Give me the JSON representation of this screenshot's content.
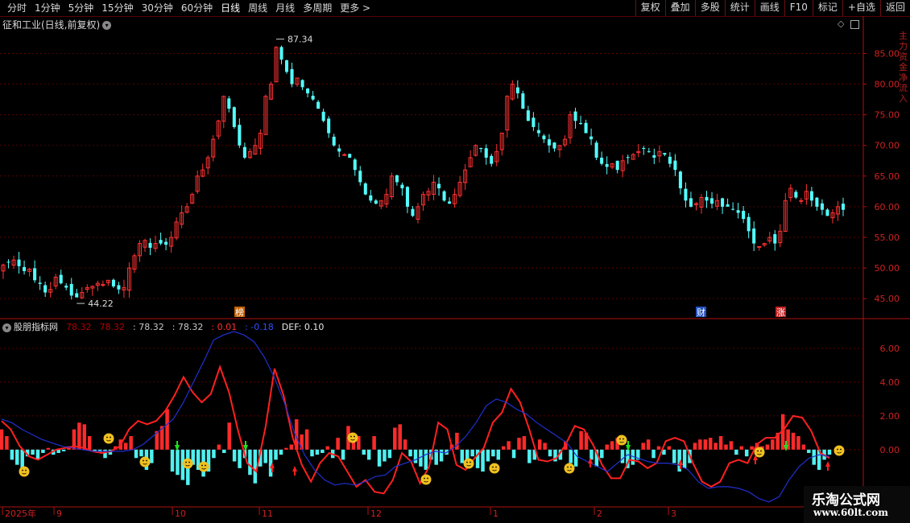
{
  "toolbar": {
    "periods": [
      "分时",
      "1分钟",
      "5分钟",
      "15分钟",
      "30分钟",
      "60分钟",
      "日线",
      "周线",
      "月线",
      "多周期",
      "更多 >"
    ],
    "active_period": "日线",
    "actions": [
      "复权",
      "叠加",
      "多股",
      "统计",
      "画线",
      "F10",
      "标记",
      "+自选",
      "返回"
    ]
  },
  "main_chart": {
    "title": "征和工业(日线,前复权)",
    "high_label": "87.34",
    "low_label": "44.22",
    "y_ticks": [
      "85.00",
      "80.00",
      "75.00",
      "70.00",
      "65.00",
      "60.00",
      "55.00",
      "50.00",
      "45.00"
    ],
    "badges": [
      {
        "text": "榜",
        "color": "#c06000"
      },
      {
        "text": "财",
        "color": "#2050c0"
      },
      {
        "text": "涨",
        "color": "#c02020"
      }
    ],
    "side_text": "主力资金净流入"
  },
  "indicator": {
    "name": "股朋指标网",
    "values": [
      {
        "text": "78.32",
        "color": "#b00000"
      },
      {
        "text": "78.32",
        "color": "#b00000"
      },
      {
        "text": ": 78.32",
        "color": "#c8c8c8"
      },
      {
        "text": ": 78.32",
        "color": "#c8c8c8"
      },
      {
        "text": ": 0.01",
        "color": "#ff3030"
      },
      {
        "text": ": -0.18",
        "color": "#3050ff"
      },
      {
        "text": "DEF: 0.10",
        "color": "#e8e8e8"
      }
    ],
    "y_ticks": [
      "6.00",
      "4.00",
      "2.00",
      "0.00"
    ]
  },
  "x_axis": {
    "labels": [
      "2025年",
      "9",
      "10",
      "11",
      "12",
      "1",
      "2",
      "3"
    ]
  },
  "watermark": {
    "line1": "乐淘公式网",
    "line2": "www.60lt.com"
  },
  "colors": {
    "up": "#ff3232",
    "down": "#54ffff",
    "grid": "#5a0000",
    "axis": "#b01010",
    "red_line": "#ff2020",
    "blue_line": "#2030d0"
  },
  "chart_data": [
    {
      "type": "candlestick",
      "title": "征和工业(日线,前复权)",
      "ylim": [
        42,
        89
      ],
      "annotations": {
        "max": 87.34,
        "min": 44.22
      },
      "closes": [
        50.5,
        51.0,
        51.3,
        50.3,
        49.5,
        49.8,
        48.0,
        47.4,
        46.0,
        46.5,
        48.5,
        47.5,
        46.8,
        45.5,
        45.2,
        46.0,
        46.8,
        47.0,
        47.5,
        47.3,
        48.0,
        47.0,
        46.5,
        46.8,
        50.0,
        52.0,
        54.0,
        54.5,
        53.3,
        54.0,
        54.0,
        53.8,
        55.0,
        57.5,
        59.0,
        60.0,
        62.0,
        65.0,
        66.0,
        68.0,
        71.0,
        74.0,
        78.0,
        76.0,
        73.0,
        70.0,
        68.0,
        69.0,
        70.0,
        72.0,
        78.0,
        80.0,
        86.0,
        84.0,
        82.0,
        80.0,
        81.0,
        79.5,
        78.5,
        77.5,
        76.0,
        74.0,
        72.0,
        70.0,
        69.0,
        68.5,
        68.0,
        66.0,
        64.0,
        62.0,
        61.0,
        60.5,
        61.0,
        62.0,
        65.0,
        64.0,
        63.0,
        60.0,
        58.5,
        60.0,
        62.0,
        62.5,
        64.0,
        63.0,
        61.0,
        60.5,
        62.0,
        64.0,
        66.0,
        68.0,
        70.0,
        69.5,
        68.0,
        67.0,
        69.0,
        72.0,
        78.0,
        80.0,
        78.5,
        76.0,
        74.0,
        73.0,
        72.0,
        71.0,
        70.0,
        69.5,
        70.0,
        71.0,
        75.0,
        74.0,
        73.5,
        72.0,
        71.0,
        68.0,
        67.0,
        66.5,
        67.0,
        66.0,
        67.5,
        68.0,
        68.5,
        69.0,
        69.5,
        69.0,
        68.0,
        69.0,
        68.5,
        67.0,
        66.0,
        63.0,
        61.0,
        60.0,
        60.5,
        61.5,
        61.0,
        60.5,
        61.0,
        60.0,
        60.0,
        59.5,
        59.0,
        58.0,
        56.0,
        54.0,
        53.5,
        54.0,
        55.0,
        54.0,
        56.0,
        61.0,
        63.0,
        61.5,
        61.0,
        62.5,
        61.0,
        60.0,
        59.5,
        58.5,
        59.0,
        60.0,
        59.5
      ]
    },
    {
      "type": "line",
      "title": "股朋指标网",
      "ylim": [
        -3.3,
        7.0
      ],
      "series": [
        {
          "name": "red",
          "color": "#ff2020",
          "values": [
            1.7,
            1.2,
            0.2,
            -0.4,
            -0.6,
            -0.3,
            0.0,
            0.1,
            0.2,
            0.1,
            -0.1,
            -0.2,
            -0.1,
            0.2,
            1.2,
            1.7,
            1.5,
            1.7,
            2.3,
            3.2,
            4.3,
            3.4,
            2.8,
            3.3,
            4.9,
            3.4,
            1.1,
            -0.8,
            -1.3,
            1.3,
            4.8,
            3.2,
            0.7,
            -0.9,
            -1.9,
            -0.8,
            -0.2,
            -0.4,
            -1.3,
            -2.2,
            -1.8,
            -2.5,
            -2.6,
            -1.8,
            -0.2,
            -0.7,
            -2.0,
            -1.0,
            1.6,
            1.2,
            -0.9,
            -1.2,
            -0.5,
            0.1,
            1.6,
            2.2,
            3.6,
            2.8,
            1.2,
            -0.6,
            -0.7,
            -0.5,
            0.3,
            1.4,
            1.2,
            0.3,
            -0.9,
            -1.7,
            -1.7,
            -0.6,
            -0.7,
            -1.1,
            -0.8,
            0.5,
            0.7,
            0.5,
            -0.8,
            -1.9,
            -2.2,
            -1.9,
            -0.8,
            -0.6,
            -0.8,
            0.3,
            0.7,
            0.7,
            1.2,
            2.0,
            1.9,
            1.1,
            -0.2,
            -0.5
          ]
        },
        {
          "name": "blue",
          "color": "#2030d0",
          "values": [
            1.8,
            1.6,
            1.2,
            0.9,
            0.6,
            0.4,
            0.2,
            0.1,
            0.0,
            -0.1,
            -0.1,
            -0.1,
            -0.1,
            0.0,
            0.3,
            0.8,
            1.3,
            1.8,
            2.8,
            4.0,
            5.2,
            6.5,
            6.8,
            7.0,
            6.8,
            6.4,
            5.5,
            4.3,
            2.8,
            1.0,
            -0.3,
            -1.2,
            -1.8,
            -2.1,
            -2.0,
            -2.1,
            -1.9,
            -1.6,
            -1.5,
            -1.0,
            -0.8,
            -0.6,
            -0.3,
            -0.1,
            -0.2,
            0.2,
            0.8,
            1.6,
            2.6,
            3.0,
            2.8,
            2.4,
            2.1,
            1.6,
            1.2,
            0.8,
            0.4,
            -0.4,
            -0.7,
            -1.0,
            -1.3,
            -0.8,
            -0.3,
            -0.5,
            -0.7,
            -0.8,
            -0.8,
            -0.9,
            -1.2,
            -1.9,
            -2.3,
            -2.2,
            -2.2,
            -2.3,
            -2.5,
            -2.9,
            -3.1,
            -2.8,
            -1.8,
            -1.0,
            -0.5,
            -0.3,
            -0.4
          ]
        }
      ],
      "bars": [
        1.2,
        0.8,
        -0.6,
        -0.9,
        -1.1,
        -0.4,
        -0.3,
        -0.6,
        -0.2,
        0.1,
        -0.3,
        -0.2,
        -0.1,
        0.2,
        1.2,
        1.6,
        1.5,
        0.8,
        -0.1,
        -0.2,
        -0.5,
        -0.3,
        0.2,
        0.6,
        0.4,
        0.8,
        -0.5,
        -0.4,
        -1.2,
        -0.8,
        1.1,
        1.4,
        2.4,
        -1.3,
        -1.5,
        -1.8,
        -2.1,
        -0.9,
        -1.2,
        -1.6,
        -1.3,
        -0.5,
        0.3,
        -0.2,
        1.6,
        -0.7,
        -1.1,
        -0.5,
        -1.5,
        -2.0,
        -1.0,
        -0.8,
        -1.6,
        -0.6,
        -0.3,
        0.1,
        0.3,
        1.8,
        0.9,
        1.2,
        -0.4,
        -0.3,
        -0.2,
        0.2,
        -0.5,
        0.7,
        -0.6,
        1.4,
        1.0,
        0.8,
        -0.3,
        -0.6,
        0.8,
        -1.0,
        -0.7,
        -0.5,
        1.3,
        1.5,
        0.6,
        -0.4,
        -0.8,
        -1.0,
        -1.2,
        -0.6,
        -0.9,
        -0.7,
        -0.3,
        0.3,
        1.0,
        -0.8,
        -0.6,
        -0.4,
        -1.1,
        -1.3,
        -0.7,
        -0.4,
        -0.6,
        0.2,
        0.5,
        -0.5,
        0.7,
        0.8,
        -0.8,
        -0.6,
        0.6,
        0.4,
        -0.4,
        -0.7,
        -0.6,
        0.5,
        -0.8,
        -1.0,
        1.1,
        1.0,
        -0.6,
        -1.0,
        -0.5,
        0.3,
        0.5,
        0.7,
        -0.8,
        -1.1,
        -0.9,
        -0.6,
        0.4,
        0.6,
        -0.5,
        0.2,
        -0.3,
        0.2,
        -0.8,
        -1.3,
        -1.1,
        -0.8,
        0.4,
        0.6,
        0.6,
        0.7,
        0.4,
        0.8,
        0.3,
        0.5,
        -0.3,
        0.2,
        -0.4,
        0.2,
        0.4,
        0.2,
        0.3,
        0.6,
        1.0,
        2.1,
        1.2,
        1.0,
        0.8,
        0.3,
        -0.2,
        -0.9,
        -1.2,
        -0.6,
        -0.3
      ]
    }
  ]
}
